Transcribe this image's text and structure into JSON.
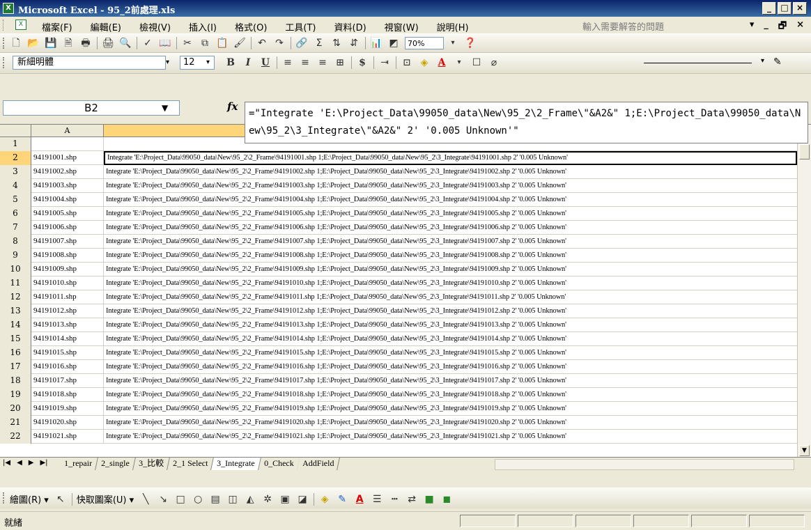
{
  "window": {
    "title": "Microsoft Excel - 95_2前處理.xls",
    "minimize": "_",
    "maximize": "□",
    "close": "×"
  },
  "menu": {
    "items": [
      "檔案(F)",
      "編輯(E)",
      "檢視(V)",
      "插入(I)",
      "格式(O)",
      "工具(T)",
      "資料(D)",
      "視窗(W)",
      "說明(H)"
    ],
    "help_placeholder": "輸入需要解答的問題",
    "doc_controls": [
      "▾",
      "_",
      "🗗",
      "×"
    ]
  },
  "standard_toolbar": {
    "zoom": "70%",
    "icons": [
      "new-icon",
      "open-icon",
      "save-icon",
      "permission-icon",
      "print-preview-icon",
      "print-icon",
      "spelling-icon",
      "research-icon",
      "cut-icon",
      "copy-icon",
      "paste-icon",
      "format-painter-icon",
      "undo-icon",
      "redo-icon",
      "hyperlink-icon",
      "autosum-icon",
      "sort-ascending-icon",
      "sort-descending-icon",
      "chart-wizard-icon",
      "drawing-icon"
    ]
  },
  "format_toolbar": {
    "font": "新細明體",
    "size": "12",
    "bold": "B",
    "italic": "I",
    "underline": "U",
    "currency": "$"
  },
  "formula_bar": {
    "cell_ref": "B2",
    "fx": "fx",
    "formula": "=\"Integrate 'E:\\Project_Data\\99050_data\\New\\95_2\\2_Frame\\\"&A2&\" 1;E:\\Project_Data\\99050_data\\New\\95_2\\3_Integrate\\\"&A2&\" 2' '0.005 Unknown'\""
  },
  "grid": {
    "col_a": "A",
    "rows": [
      {
        "n": "1",
        "a": "",
        "b": ""
      },
      {
        "n": "2",
        "a": "94191001.shp",
        "b": "Integrate 'E:\\Project_Data\\99050_data\\New\\95_2\\2_Frame\\94191001.shp 1;E:\\Project_Data\\99050_data\\New\\95_2\\3_Integrate\\94191001.shp 2' '0.005 Unknown'"
      },
      {
        "n": "3",
        "a": "94191002.shp",
        "b": "Integrate 'E:\\Project_Data\\99050_data\\New\\95_2\\2_Frame\\94191002.shp 1;E:\\Project_Data\\99050_data\\New\\95_2\\3_Integrate\\94191002.shp 2' '0.005 Unknown'"
      },
      {
        "n": "4",
        "a": "94191003.shp",
        "b": "Integrate 'E:\\Project_Data\\99050_data\\New\\95_2\\2_Frame\\94191003.shp 1;E:\\Project_Data\\99050_data\\New\\95_2\\3_Integrate\\94191003.shp 2' '0.005 Unknown'"
      },
      {
        "n": "5",
        "a": "94191004.shp",
        "b": "Integrate 'E:\\Project_Data\\99050_data\\New\\95_2\\2_Frame\\94191004.shp 1;E:\\Project_Data\\99050_data\\New\\95_2\\3_Integrate\\94191004.shp 2' '0.005 Unknown'"
      },
      {
        "n": "6",
        "a": "94191005.shp",
        "b": "Integrate 'E:\\Project_Data\\99050_data\\New\\95_2\\2_Frame\\94191005.shp 1;E:\\Project_Data\\99050_data\\New\\95_2\\3_Integrate\\94191005.shp 2' '0.005 Unknown'"
      },
      {
        "n": "7",
        "a": "94191006.shp",
        "b": "Integrate 'E:\\Project_Data\\99050_data\\New\\95_2\\2_Frame\\94191006.shp 1;E:\\Project_Data\\99050_data\\New\\95_2\\3_Integrate\\94191006.shp 2' '0.005 Unknown'"
      },
      {
        "n": "8",
        "a": "94191007.shp",
        "b": "Integrate 'E:\\Project_Data\\99050_data\\New\\95_2\\2_Frame\\94191007.shp 1;E:\\Project_Data\\99050_data\\New\\95_2\\3_Integrate\\94191007.shp 2' '0.005 Unknown'"
      },
      {
        "n": "9",
        "a": "94191008.shp",
        "b": "Integrate 'E:\\Project_Data\\99050_data\\New\\95_2\\2_Frame\\94191008.shp 1;E:\\Project_Data\\99050_data\\New\\95_2\\3_Integrate\\94191008.shp 2' '0.005 Unknown'"
      },
      {
        "n": "10",
        "a": "94191009.shp",
        "b": "Integrate 'E:\\Project_Data\\99050_data\\New\\95_2\\2_Frame\\94191009.shp 1;E:\\Project_Data\\99050_data\\New\\95_2\\3_Integrate\\94191009.shp 2' '0.005 Unknown'"
      },
      {
        "n": "11",
        "a": "94191010.shp",
        "b": "Integrate 'E:\\Project_Data\\99050_data\\New\\95_2\\2_Frame\\94191010.shp 1;E:\\Project_Data\\99050_data\\New\\95_2\\3_Integrate\\94191010.shp 2' '0.005 Unknown'"
      },
      {
        "n": "12",
        "a": "94191011.shp",
        "b": "Integrate 'E:\\Project_Data\\99050_data\\New\\95_2\\2_Frame\\94191011.shp 1;E:\\Project_Data\\99050_data\\New\\95_2\\3_Integrate\\94191011.shp 2' '0.005 Unknown'"
      },
      {
        "n": "13",
        "a": "94191012.shp",
        "b": "Integrate 'E:\\Project_Data\\99050_data\\New\\95_2\\2_Frame\\94191012.shp 1;E:\\Project_Data\\99050_data\\New\\95_2\\3_Integrate\\94191012.shp 2' '0.005 Unknown'"
      },
      {
        "n": "14",
        "a": "94191013.shp",
        "b": "Integrate 'E:\\Project_Data\\99050_data\\New\\95_2\\2_Frame\\94191013.shp 1;E:\\Project_Data\\99050_data\\New\\95_2\\3_Integrate\\94191013.shp 2' '0.005 Unknown'"
      },
      {
        "n": "15",
        "a": "94191014.shp",
        "b": "Integrate 'E:\\Project_Data\\99050_data\\New\\95_2\\2_Frame\\94191014.shp 1;E:\\Project_Data\\99050_data\\New\\95_2\\3_Integrate\\94191014.shp 2' '0.005 Unknown'"
      },
      {
        "n": "16",
        "a": "94191015.shp",
        "b": "Integrate 'E:\\Project_Data\\99050_data\\New\\95_2\\2_Frame\\94191015.shp 1;E:\\Project_Data\\99050_data\\New\\95_2\\3_Integrate\\94191015.shp 2' '0.005 Unknown'"
      },
      {
        "n": "17",
        "a": "94191016.shp",
        "b": "Integrate 'E:\\Project_Data\\99050_data\\New\\95_2\\2_Frame\\94191016.shp 1;E:\\Project_Data\\99050_data\\New\\95_2\\3_Integrate\\94191016.shp 2' '0.005 Unknown'"
      },
      {
        "n": "18",
        "a": "94191017.shp",
        "b": "Integrate 'E:\\Project_Data\\99050_data\\New\\95_2\\2_Frame\\94191017.shp 1;E:\\Project_Data\\99050_data\\New\\95_2\\3_Integrate\\94191017.shp 2' '0.005 Unknown'"
      },
      {
        "n": "19",
        "a": "94191018.shp",
        "b": "Integrate 'E:\\Project_Data\\99050_data\\New\\95_2\\2_Frame\\94191018.shp 1;E:\\Project_Data\\99050_data\\New\\95_2\\3_Integrate\\94191018.shp 2' '0.005 Unknown'"
      },
      {
        "n": "20",
        "a": "94191019.shp",
        "b": "Integrate 'E:\\Project_Data\\99050_data\\New\\95_2\\2_Frame\\94191019.shp 1;E:\\Project_Data\\99050_data\\New\\95_2\\3_Integrate\\94191019.shp 2' '0.005 Unknown'"
      },
      {
        "n": "21",
        "a": "94191020.shp",
        "b": "Integrate 'E:\\Project_Data\\99050_data\\New\\95_2\\2_Frame\\94191020.shp 1;E:\\Project_Data\\99050_data\\New\\95_2\\3_Integrate\\94191020.shp 2' '0.005 Unknown'"
      },
      {
        "n": "22",
        "a": "94191021.shp",
        "b": "Integrate 'E:\\Project_Data\\99050_data\\New\\95_2\\2_Frame\\94191021.shp 1;E:\\Project_Data\\99050_data\\New\\95_2\\3_Integrate\\94191021.shp 2' '0.005 Unknown'"
      }
    ]
  },
  "sheet_tabs": {
    "tabs": [
      "1_repair",
      "2_single",
      "3_比較",
      "2_1 Select",
      "3_Integrate",
      "0_Check",
      "AddField"
    ],
    "active": "3_Integrate"
  },
  "drawing_toolbar": {
    "draw": "繪圖(R) ▾",
    "autoshapes": "快取圖案(U) ▾"
  },
  "status": {
    "text": "就緒"
  },
  "colors": {
    "title_bar": "#0a246a",
    "header_highlight": "#ffd57a",
    "chrome": "#ece9d8"
  }
}
